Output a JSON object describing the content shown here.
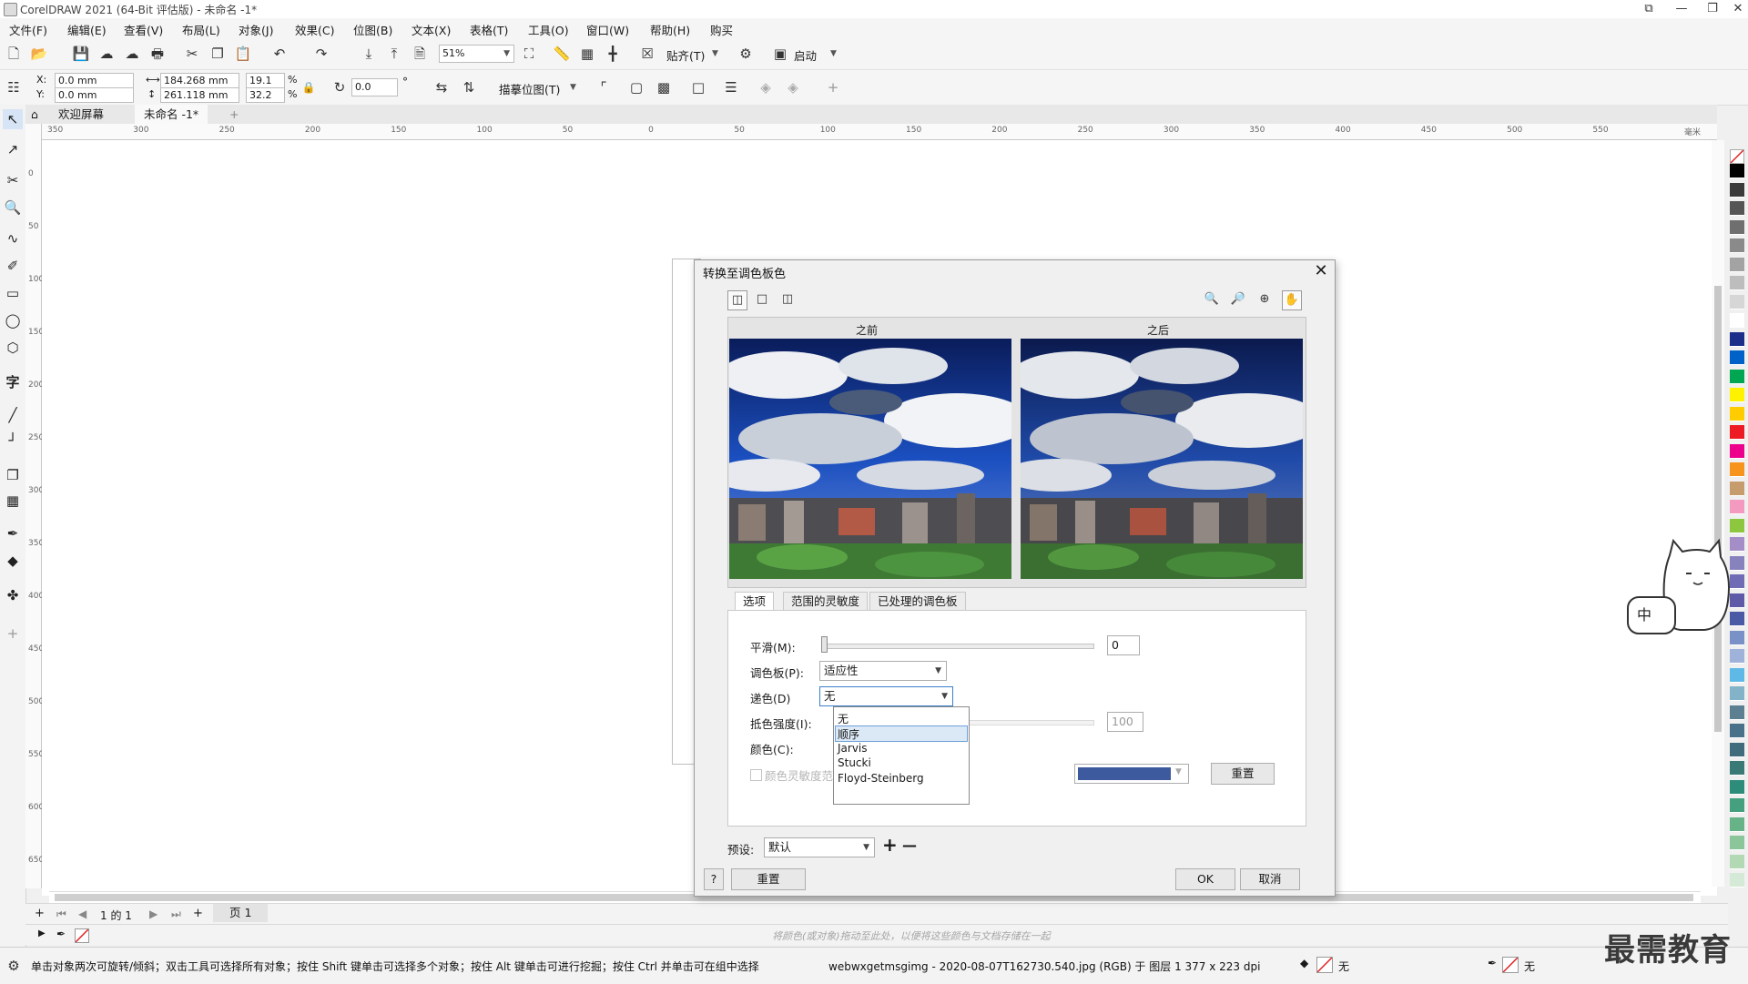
{
  "window": {
    "title": "CorelDRAW 2021 (64-Bit 评估版) - 未命名 -1*",
    "min": "—",
    "restore": "❐",
    "close": "✕",
    "extra": "⧉"
  },
  "menu": [
    "文件(F)",
    "编辑(E)",
    "查看(V)",
    "布局(L)",
    "对象(J)",
    "效果(C)",
    "位图(B)",
    "文本(X)",
    "表格(T)",
    "工具(O)",
    "窗口(W)",
    "帮助(H)",
    "购买"
  ],
  "toolbar": {
    "zoom": "51%",
    "snap_label": "贴齐(T)",
    "launch_label": "启动"
  },
  "propbar": {
    "x_label": "X:",
    "y_label": "Y:",
    "x": "0.0 mm",
    "y": "0.0 mm",
    "w": "184.268 mm",
    "h": "261.118 mm",
    "sx": "19.1",
    "sy": "32.2",
    "pct": "%",
    "angle": "0.0",
    "deg": "°",
    "trace_label": "描摹位图(T)"
  },
  "doc_tabs": {
    "welcome": "欢迎屏幕",
    "current": "未命名 -1*",
    "add": "+"
  },
  "ruler_h": [
    "350",
    "300",
    "250",
    "200",
    "150",
    "100",
    "50",
    "0",
    "50",
    "100",
    "150",
    "200",
    "250",
    "300",
    "350",
    "400",
    "450",
    "500",
    "550",
    "毫米"
  ],
  "ruler_v": [
    "0",
    "50",
    "100",
    "150",
    "200",
    "250",
    "300",
    "350",
    "400",
    "450",
    "500",
    "550",
    "600",
    "650"
  ],
  "dialog": {
    "title": "转换至调色板色",
    "before_label": "之前",
    "after_label": "之后",
    "tabs": [
      "选项",
      "范围的灵敏度",
      "已处理的调色板"
    ],
    "smooth_label": "平滑(M):",
    "smooth_value": "0",
    "palette_label": "调色板(P):",
    "palette_value": "适应性",
    "dither_label": "递色(D)",
    "dither_value": "无",
    "dither_options": [
      "无",
      "顺序",
      "Jarvis",
      "Stucki",
      "Floyd-Steinberg"
    ],
    "dither_highlight_index": 1,
    "strength_label": "抵色强度(I):",
    "strength_value": "100",
    "colors_label": "颜色(C):",
    "sensitivity_label": "颜色灵敏度范",
    "reset_color_btn": "重置",
    "swatch_color": "#3d5a9e",
    "preset_label": "预设:",
    "preset_value": "默认",
    "preset_add": "+",
    "preset_remove": "—",
    "help_btn": "?",
    "reset_btn": "重置",
    "ok_btn": "OK",
    "cancel_btn": "取消"
  },
  "pages": {
    "of_label": "1 的 1",
    "page_tab": "页 1"
  },
  "colorbar_hint": "将颜色(或对象)拖动至此处，以便将这些颜色与文档存储在一起",
  "status": {
    "hint": "单击对象两次可旋转/倾斜；双击工具可选择所有对象；按住 Shift 键单击可选择多个对象；按住 Alt 键单击可进行挖掘；按住 Ctrl 并单击可在组中选择",
    "file_info": "webwxgetmsgimg - 2020-08-07T162730.540.jpg (RGB) 于 图层 1 377 x 223 dpi",
    "fill_none": "无",
    "outline_none": "无"
  },
  "mascot": {
    "text": "中"
  },
  "watermark": "最需教育",
  "palette_colors": [
    "#000000",
    "#3a3a3a",
    "#555555",
    "#6f6f6f",
    "#8a8a8a",
    "#a3a3a3",
    "#bdbdbd",
    "#d6d6d6",
    "#ffffff",
    "#1b2e8a",
    "#0061c8",
    "#00a651",
    "#fff200",
    "#ffcc00",
    "#ed1c24",
    "#ec008c",
    "#f7941d",
    "#c69c6d",
    "#f49ac1",
    "#8dc63f",
    "#a58ec7",
    "#8781bd",
    "#6f6bb4",
    "#5e5aa8",
    "#4b5aa5",
    "#7a91c8",
    "#9fb2d9",
    "#5fb9e6",
    "#82b3c9",
    "#5c7f91",
    "#49718a",
    "#3f6b7c",
    "#397a76",
    "#2d8d7a",
    "#45a07f",
    "#65b387",
    "#8bc59a",
    "#b2d8b4",
    "#d5ead6"
  ]
}
